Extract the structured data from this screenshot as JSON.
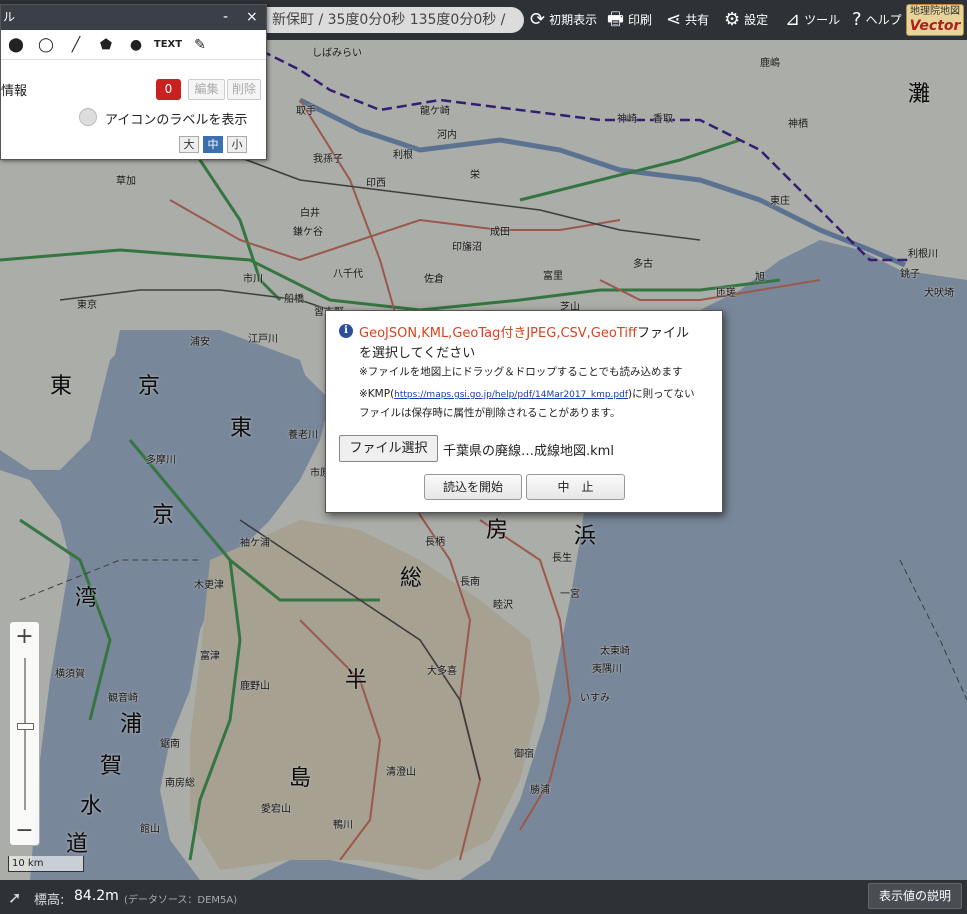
{
  "topbar": {
    "location": "新保町 / 35度0分0秒 135度0分0秒 /",
    "buttons": [
      {
        "label": "初期表示",
        "icon": "refresh-icon"
      },
      {
        "label": "印刷",
        "icon": "printer-icon"
      },
      {
        "label": "共有",
        "icon": "share-icon"
      },
      {
        "label": "設定",
        "icon": "gear-icon"
      },
      {
        "label": "ツール",
        "icon": "tool-icon"
      },
      {
        "label": "ヘルプ",
        "icon": "help-icon"
      }
    ],
    "logo_line1": "地理院地図",
    "logo_line2": "Vector"
  },
  "panel": {
    "title": "ル",
    "minimize": "-",
    "close": "×",
    "text_tool": "TEXT",
    "info_label": "情報",
    "count": "0",
    "edit_label": "編集",
    "delete_label": "削除",
    "label_toggle_text": "アイコンのラベルを表示",
    "size_large": "大",
    "size_medium": "中",
    "size_small": "小"
  },
  "dialog": {
    "formats": "GeoJSON,KML,GeoTag付きJPEG,CSV,GeoTiff",
    "line1_suffix": "ファイル",
    "line2": "を選択してください",
    "note1": "※ファイルを地図上にドラッグ＆ドロップすることでも読み込めます",
    "note2_prefix": "※KMP(",
    "note2_link": "https://maps.gsi.go.jp/help/pdf/14Mar2017_kmp.pdf",
    "note2_suffix": ")に則ってない",
    "note3": "ファイルは保存時に属性が削除されることがあります。",
    "file_button": "ファイル選択",
    "file_name": "千葉県の廃線…成線地図.kml",
    "start_button": "読込を開始",
    "cancel_button": "中　止"
  },
  "zoom": {
    "plus": "+",
    "minus": "−",
    "scale": "10 km"
  },
  "bottombar": {
    "elev_label": "標高:",
    "elev_value": "84.2m",
    "elev_source": "(データソース：DEM5A)",
    "explain_button": "表示値の説明"
  },
  "map": {
    "big_labels": [
      "東",
      "京",
      "東",
      "京",
      "湾",
      "浦",
      "賀",
      "水",
      "道",
      "房",
      "総",
      "半",
      "島",
      "浜",
      "灘"
    ],
    "place_labels": [
      "しばみらい",
      "龍ケ崎",
      "河内",
      "神崎",
      "香取",
      "鹿嶋",
      "神栖",
      "取手",
      "我孫子",
      "利根",
      "栄",
      "印西",
      "成田",
      "白井",
      "鎌ケ谷",
      "印旛沼",
      "八千代",
      "佐倉",
      "富里",
      "多古",
      "市川",
      "船橋",
      "習志野",
      "東京",
      "浦安",
      "旭",
      "匝瑳",
      "銚子",
      "犬吠埼",
      "養老川",
      "市原",
      "袖ケ浦",
      "木更津",
      "富津",
      "長柄",
      "長南",
      "一宮",
      "睦沢",
      "大多喜",
      "いすみ",
      "勝浦",
      "御宿",
      "鴨川",
      "館山",
      "南房総",
      "鋸南",
      "鹿野山",
      "清澄山",
      "愛宕山",
      "太東崎",
      "夷隅川",
      "利根川",
      "東庄",
      "草加",
      "多摩川",
      "横須賀",
      "観音崎",
      "芝山",
      "江戸川",
      "長生"
    ]
  }
}
